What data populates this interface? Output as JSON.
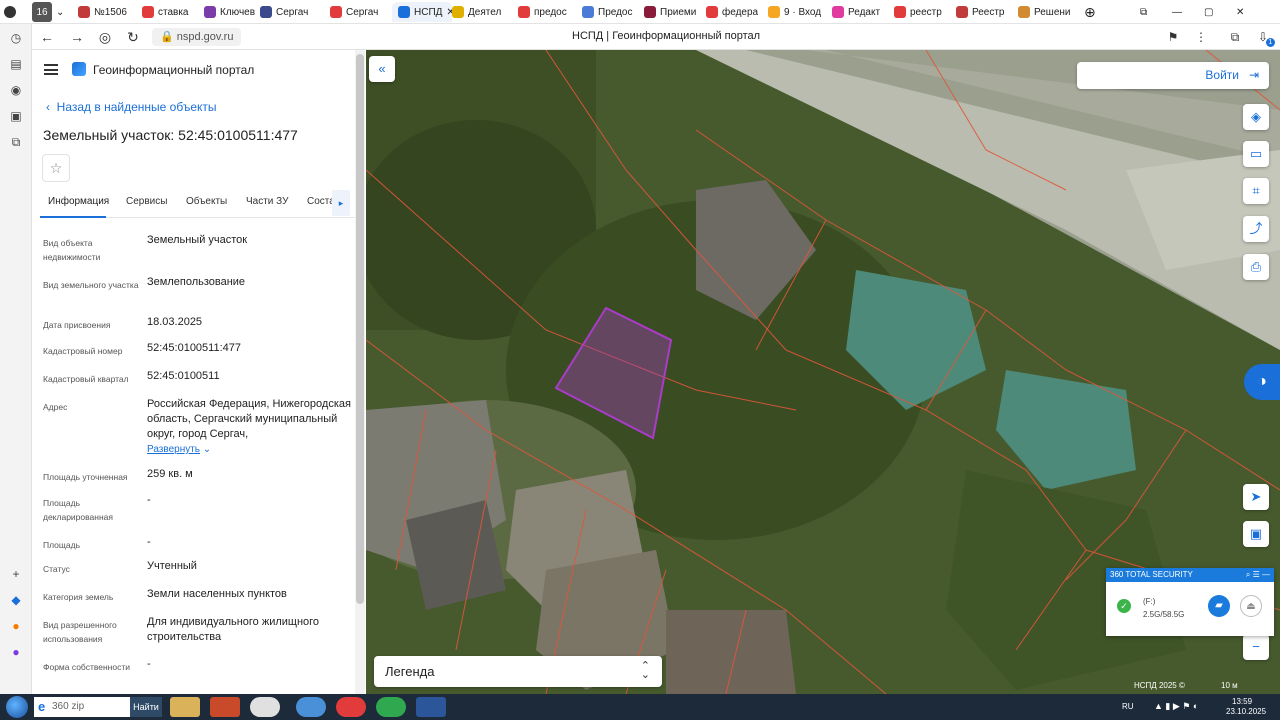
{
  "browser": {
    "tab_count": "16",
    "tabs": [
      {
        "label": "№1506",
        "color": "#c23b3b"
      },
      {
        "label": "ставка",
        "color": "#e23b3b"
      },
      {
        "label": "Ключев",
        "color": "#7b3ba8"
      },
      {
        "label": "Сергач",
        "color": "#3b4a8c"
      },
      {
        "label": "Сергач",
        "color": "#e23b3b"
      },
      {
        "label": "НСПД",
        "color": "#1b6fd8",
        "active": true
      },
      {
        "label": "Деятел",
        "color": "#e0b000"
      },
      {
        "label": "предос",
        "color": "#e23b3b"
      },
      {
        "label": "Предос",
        "color": "#4a7bd8"
      },
      {
        "label": "Приеми",
        "color": "#8a1c3a"
      },
      {
        "label": "федера",
        "color": "#e23b3b"
      },
      {
        "label": "9 · Вход",
        "color": "#f5a623"
      },
      {
        "label": "Редакт",
        "color": "#e23ba0"
      },
      {
        "label": "реестр",
        "color": "#e23b3b"
      },
      {
        "label": "Реестр",
        "color": "#c23b3b"
      },
      {
        "label": "Решени",
        "color": "#d08a30"
      }
    ],
    "url": "nspd.gov.ru",
    "page_title": "НСПД | Геоинформационный портал",
    "download_count": "1"
  },
  "sidebar": {
    "portal_name": "Геоинформационный портал",
    "back_link": "Назад в найденные объекты",
    "object_title": "Земельный участок: 52:45:0100511:477",
    "tabs": [
      "Информация",
      "Сервисы",
      "Объекты",
      "Части ЗУ",
      "Состав"
    ],
    "properties": [
      {
        "label": "Вид объекта недвижимости",
        "value": "Земельный участок"
      },
      {
        "label": "Вид земельного участка",
        "value": "Землепользование"
      },
      {
        "label": "Дата присвоения",
        "value": "18.03.2025"
      },
      {
        "label": "Кадастровый номер",
        "value": "52:45:0100511:477"
      },
      {
        "label": "Кадастровый квартал",
        "value": "52:45:0100511"
      },
      {
        "label": "Адрес",
        "value": "Российская Федерация, Нижегородская область, Сергачский муниципальный округ, город Сергач,"
      },
      {
        "label": "Площадь уточненная",
        "value": "259 кв. м"
      },
      {
        "label": "Площадь декларированная",
        "value": "-"
      },
      {
        "label": "Площадь",
        "value": "-"
      },
      {
        "label": "Статус",
        "value": "Учтенный"
      },
      {
        "label": "Категория земель",
        "value": "Земли населенных пунктов"
      },
      {
        "label": "Вид разрешенного использования",
        "value": "Для индивидуального жилищного строительства"
      },
      {
        "label": "Форма собственности",
        "value": "-"
      }
    ],
    "expand_label": "Развернуть"
  },
  "map": {
    "login_label": "Войти",
    "legend_label": "Легенда",
    "attribution": "НСПД 2025 ©",
    "scale_label": "10 м",
    "parcel_color": "#a93cc8",
    "boundary_color": "#e0563a"
  },
  "security_widget": {
    "title": "360 TOTAL SECURITY",
    "drive": "(F:)",
    "size": "2.5G/58.5G"
  },
  "taskbar": {
    "search_placeholder": "360 zip",
    "search_button": "Найти",
    "lang": "RU",
    "time": "13:59",
    "date": "23.10.2025"
  }
}
